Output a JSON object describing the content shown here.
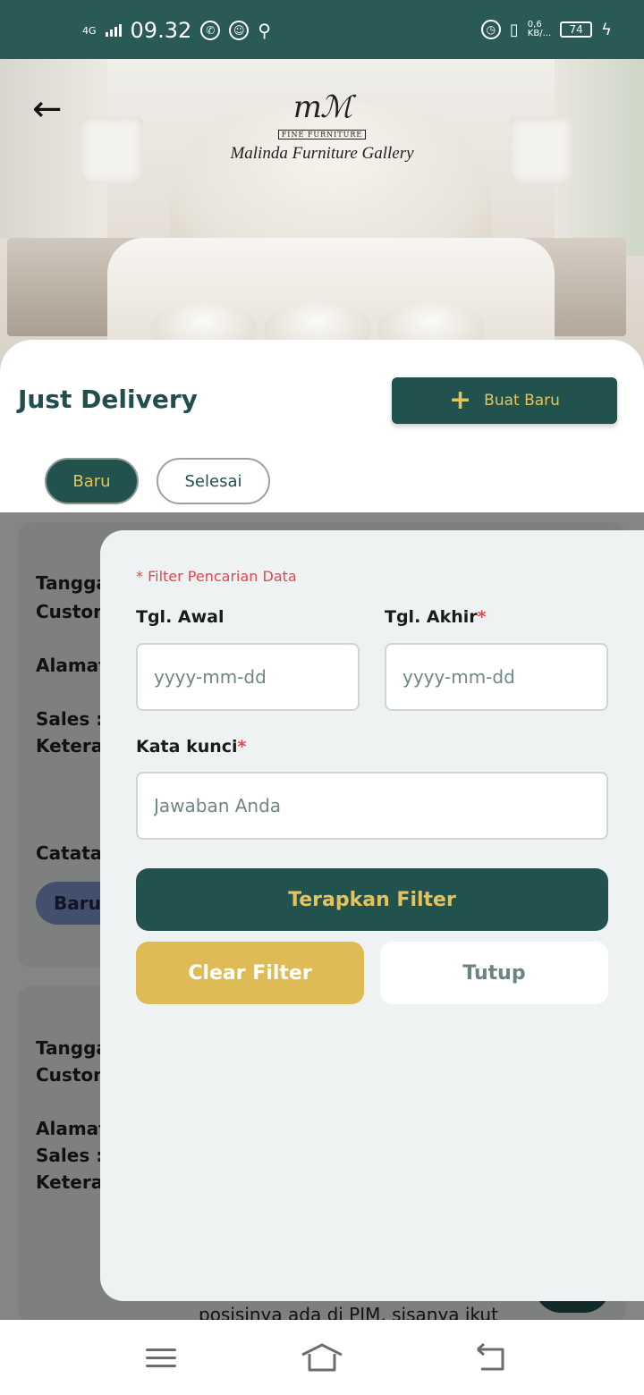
{
  "status_bar": {
    "network": "4G",
    "time": "09.32",
    "speed_value": "0,6",
    "speed_unit": "KB/...",
    "battery": "74"
  },
  "header": {
    "logo_tag": "FINE FURNITURE",
    "logo_name": "Malinda Furniture Gallery"
  },
  "page": {
    "title": "Just Delivery",
    "new_button_label": "Buat Baru",
    "tabs": [
      {
        "label": "Baru"
      },
      {
        "label": "Selesai"
      }
    ]
  },
  "background_list": {
    "card1": {
      "tanggal_label": "Tangga",
      "customer_label": "Custom",
      "alamat_label": "Alamat",
      "sales_label": "Sales :",
      "keterangan_label": "Keterar",
      "catatan_label": "Catatar",
      "status_chip": "Baru"
    },
    "card2": {
      "tanggal_label": "Tangga",
      "customer_label": "Custom",
      "alamat_label": "Alamat",
      "sales_label": "Sales :",
      "keterangan_label": "Keterar"
    },
    "peek_text": "posisinya ada di PIM, sisanya ikut"
  },
  "filter": {
    "hint": "* Filter Pencarian Data",
    "start_date_label": "Tgl. Awal",
    "end_date_label": "Tgl. Akhir",
    "required_mark": "*",
    "date_placeholder": "yyyy-mm-dd",
    "keyword_label": "Kata kunci",
    "keyword_placeholder": "Jawaban Anda",
    "apply_label": "Terapkan Filter",
    "clear_label": "Clear Filter",
    "close_label": "Tutup"
  },
  "colors": {
    "primary": "#22524e",
    "accent": "#e6c35a",
    "clear_button": "#dfbb55",
    "required": "#e2474f"
  }
}
